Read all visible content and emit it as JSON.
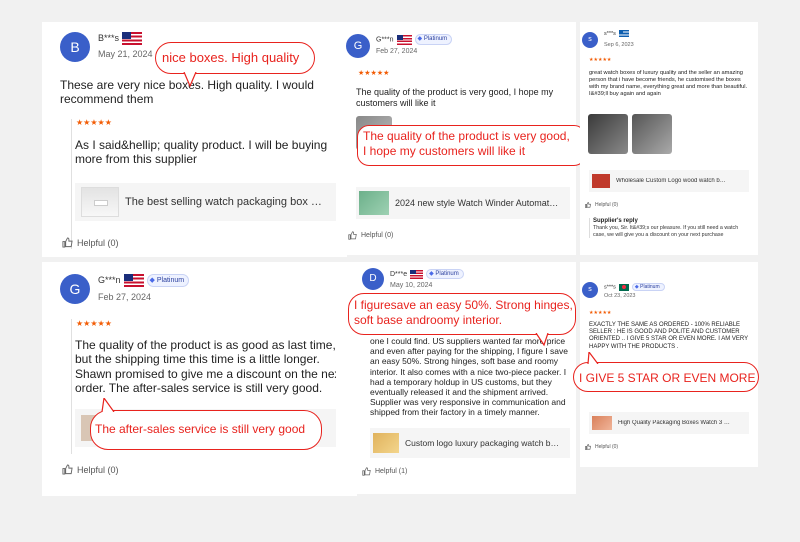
{
  "reviews": {
    "r1": {
      "avatar": "B",
      "user": "B***s",
      "date": "May 21, 2024",
      "text": "These are very nice boxes. High quality. I would recommend them",
      "stars": "★★★★★",
      "quote": "As I said&hellip; quality product. I will be buying more from this supplier",
      "product": "The best selling watch packaging box …",
      "helpful": "Helpful (0)",
      "bubble": "nice boxes. High quality"
    },
    "r2": {
      "avatar": "G",
      "user": "G***n",
      "badge": "Platinum",
      "date": "Feb 27, 2024",
      "stars": "★★★★★",
      "text": "The quality of the product is as good as last time, but the shipping time this time is a little longer. Shawn promised to give me a discount on the next order. The after-sales service is still very good.",
      "product_hidden": "",
      "helpful": "Helpful (0)",
      "bubble": "The after-sales service is still very good"
    },
    "r3": {
      "avatar": "G",
      "user": "G***n",
      "badge": "Platinum",
      "date": "Feb 27, 2024",
      "stars": "★★★★★",
      "text": "The quality of the product is very good, I hope my customers will like it",
      "product": "2024 new style Watch Winder Automat…",
      "helpful": "Helpful (0)",
      "bubble_line1": "The quality of the product is very good,",
      "bubble_line2": "I hope my customers will like it"
    },
    "r4": {
      "avatar": "D",
      "user": "D***e",
      "badge": "Platinum",
      "date": "May 10, 2024",
      "text": "one I could find. US suppliers wanted far more price and even after paying for the shipping, I figure I save an easy 50%. Strong hinges, soft base and roomy interior. It also comes with a nice two-piece packer. I had a temporary holdup in US customs, but they eventually released it and the shipment arrived. Supplier was very responsive in communication and shipped from their factory in a timely manner.",
      "product": "Custom logo luxury packaging watch b…",
      "helpful": "Helpful (1)",
      "bubble_line1": "I figuresave an easy 50%. Strong hinges,",
      "bubble_line2": "soft base androomy interior."
    },
    "r5": {
      "avatar": "s",
      "user": "s***s",
      "date": "Sep 6, 2023",
      "stars": "★★★★★",
      "text": "great watch boxes of luxury quality and the seller an amazing person that i have become friends, he customised the boxes with my brand name, everything great and more than beautiful. I&#39;ll buy again and again",
      "product": "Wholesale Custom Logo wood watch b…",
      "helpful": "Helpful (0)",
      "reply_title": "Supplier's reply",
      "reply_text": "Thank you, Sir. It&#39;s our pleasure. If you still need a watch case, we will give you a discount on your next purchase"
    },
    "r6": {
      "avatar": "s",
      "user": "s***s",
      "badge": "Platinum",
      "date": "Oct 23, 2023",
      "stars": "★★★★★",
      "text": "EXACTLY THE SAME AS ORDERED - 100% RELIABLE SELLER : HE IS GOOD AND POLITE AND CUSTOMER ORIENTED .. I GIVE 5 STAR OR EVEN MORE. I AM VERY HAPPY WITH THE PRODUCTS .",
      "product": "High Quality Packaging Boxes Watch 3 …",
      "helpful": "Helpful (0)",
      "bubble": "I GIVE 5 STAR OR EVEN MORE"
    }
  },
  "colors": {
    "accent_red": "#e8231e",
    "avatar_blue": "#3a5fc9",
    "star_orange": "#f25c05"
  }
}
